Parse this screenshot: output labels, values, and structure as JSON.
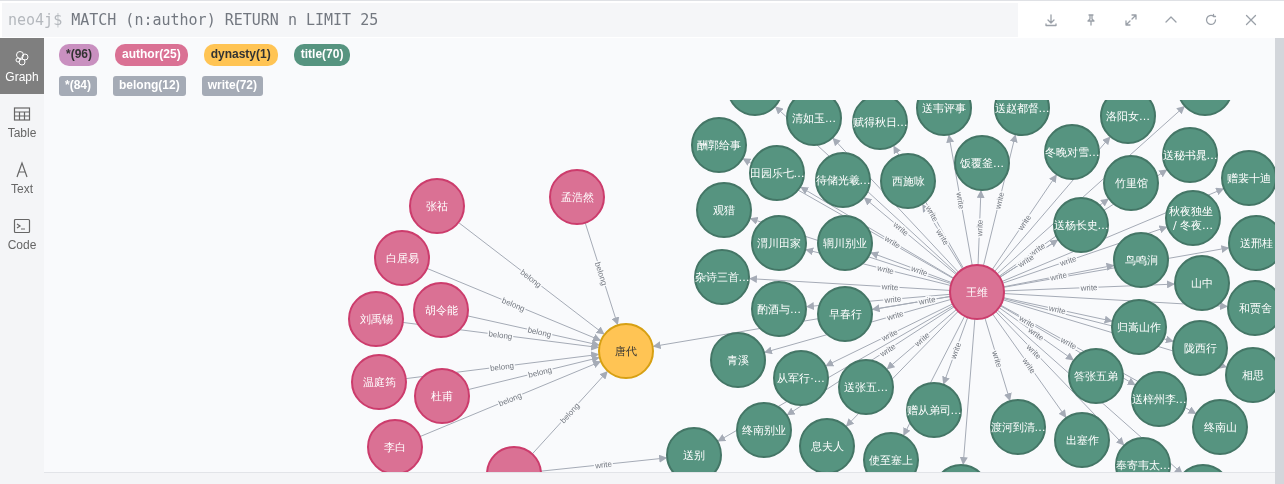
{
  "query_bar": {
    "prompt": "neo4j$",
    "query": "MATCH (n:author) RETURN n LIMIT 25"
  },
  "sidebar": [
    {
      "label": "Graph",
      "kind": "graph",
      "selected": true
    },
    {
      "label": "Table",
      "kind": "table",
      "selected": false
    },
    {
      "label": "Text",
      "kind": "text",
      "selected": false
    },
    {
      "label": "Code",
      "kind": "code",
      "selected": false
    }
  ],
  "node_labels": [
    {
      "text": "*(96)",
      "color": "#c990c0"
    },
    {
      "text": "author(25)",
      "color": "#da7194"
    },
    {
      "text": "dynasty(1)",
      "color": "#ffc454"
    },
    {
      "text": "title(70)",
      "color": "#569480"
    }
  ],
  "relationship_types": [
    {
      "text": "*(84)"
    },
    {
      "text": "belong(12)"
    },
    {
      "text": "write(72)"
    }
  ],
  "graph": {
    "nodes": [
      {
        "kind": "title"
      },
      {
        "label": "清如玉…",
        "kind": "title"
      },
      {
        "label": "赋得秋日…",
        "kind": "title"
      },
      {
        "label": "送韦评事",
        "kind": "title"
      },
      {
        "label": "送赵都督…",
        "kind": "title"
      },
      {
        "label": "洛阳女…",
        "kind": "title"
      },
      {
        "kind": "title"
      },
      {
        "label": "酬郭给事",
        "kind": "title"
      },
      {
        "label": "田园乐七…",
        "kind": "title"
      },
      {
        "label": "待储光羲…",
        "kind": "title"
      },
      {
        "label": "西施咏",
        "kind": "title"
      },
      {
        "label": "饭覆釜…",
        "kind": "title"
      },
      {
        "label": "冬晚对雪…",
        "kind": "title"
      },
      {
        "label": "竹里馆",
        "kind": "title"
      },
      {
        "label": "送秘书晁…",
        "kind": "title"
      },
      {
        "label": "赠裴十迪",
        "kind": "title"
      },
      {
        "label": "张祜",
        "kind": "author"
      },
      {
        "label": "孟浩然",
        "kind": "author"
      },
      {
        "label": "观猎",
        "kind": "title"
      },
      {
        "label": "送杨长史…",
        "kind": "title"
      },
      {
        "label": "秋夜独坐 / 冬夜…",
        "kind": "title"
      },
      {
        "label": "渭川田家",
        "kind": "title"
      },
      {
        "label": "辋川别业",
        "kind": "title"
      },
      {
        "label": "送邢桂",
        "kind": "title"
      },
      {
        "label": "白居易",
        "kind": "author"
      },
      {
        "label": "鸟鸣涧",
        "kind": "title"
      },
      {
        "label": "杂诗三首…",
        "kind": "title"
      },
      {
        "label": "王维",
        "kind": "author"
      },
      {
        "label": "山中",
        "kind": "title"
      },
      {
        "label": "刘禹锡",
        "kind": "author"
      },
      {
        "label": "胡令能",
        "kind": "author"
      },
      {
        "label": "酌酒与…",
        "kind": "title"
      },
      {
        "label": "早春行",
        "kind": "title"
      },
      {
        "label": "归嵩山作",
        "kind": "title"
      },
      {
        "label": "和贾舍",
        "kind": "title"
      },
      {
        "label": "唐代",
        "kind": "dynasty"
      },
      {
        "label": "青溪",
        "kind": "title"
      },
      {
        "label": "陇西行",
        "kind": "title"
      },
      {
        "label": "温庭筠",
        "kind": "author"
      },
      {
        "label": "杜甫",
        "kind": "author"
      },
      {
        "label": "从军行·…",
        "kind": "title"
      },
      {
        "label": "送张五…",
        "kind": "title"
      },
      {
        "label": "赠从弟司…",
        "kind": "title"
      },
      {
        "label": "答张五弟",
        "kind": "title"
      },
      {
        "label": "送梓州李…",
        "kind": "title"
      },
      {
        "label": "相思",
        "kind": "title"
      },
      {
        "label": "李白",
        "kind": "author"
      },
      {
        "label": "送别",
        "kind": "title"
      },
      {
        "label": "终南别业",
        "kind": "title"
      },
      {
        "label": "息夫人",
        "kind": "title"
      },
      {
        "label": "使至塞上",
        "kind": "title"
      },
      {
        "label": "渡河到清…",
        "kind": "title"
      },
      {
        "label": "出塞作",
        "kind": "title"
      },
      {
        "label": "奉寄韦太…",
        "kind": "title"
      },
      {
        "label": "终南山",
        "kind": "title"
      },
      {
        "kind": "author"
      },
      {
        "kind": "title"
      },
      {
        "kind": "title"
      }
    ],
    "relationships": [
      {
        "label": "belong"
      },
      {
        "label": "belong"
      },
      {
        "label": "belong"
      },
      {
        "label": "belong"
      },
      {
        "label": "belong"
      },
      {
        "label": "belong"
      },
      {
        "label": "belong"
      },
      {
        "label": "belong"
      },
      {
        "label": "belong"
      },
      {
        "label": "write"
      },
      {
        "label": "write"
      },
      {
        "label": "write"
      },
      {
        "label": "write"
      },
      {
        "label": "write"
      },
      {
        "label": "write"
      },
      {
        "label": "write"
      },
      {
        "label": "write"
      },
      {
        "label": "write"
      },
      {
        "label": "write"
      },
      {
        "label": "write"
      },
      {
        "label": "write"
      },
      {
        "label": "write"
      },
      {
        "label": "write"
      },
      {
        "label": "write"
      },
      {
        "label": "write"
      },
      {
        "label": "write"
      },
      {
        "label": "write"
      },
      {
        "label": "write"
      },
      {
        "label": "write"
      },
      {
        "label": "write"
      },
      {
        "label": "write"
      },
      {
        "label": "write"
      },
      {
        "label": "write"
      },
      {
        "label": "write"
      },
      {
        "label": "write"
      },
      {
        "label": "write"
      },
      {
        "label": "write"
      },
      {
        "label": "write"
      },
      {
        "label": "write"
      },
      {
        "label": "write"
      }
    ]
  }
}
